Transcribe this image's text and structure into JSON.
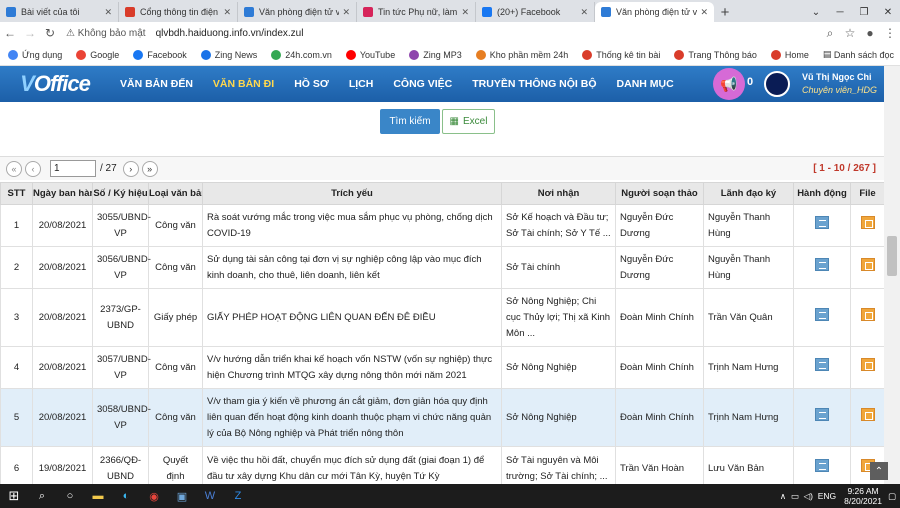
{
  "browser": {
    "tabs": [
      {
        "title": "Bài viết của tôi",
        "color": "#2e7bd6"
      },
      {
        "title": "Cổng thông tin điện tử",
        "color": "#d93c2a"
      },
      {
        "title": "Văn phòng điện tử vOffice",
        "color": "#2e7bd6"
      },
      {
        "title": "Tin tức Phụ nữ, làm đẹp",
        "color": "#d6245a"
      },
      {
        "title": "(20+) Facebook",
        "color": "#1877f2"
      },
      {
        "title": "Văn phòng điện tử vOffice",
        "color": "#2e7bd6"
      }
    ],
    "new_tab": "+",
    "url_security": "Không bảo mật",
    "url": "qlvbdh.haiduong.info.vn/index.zul",
    "bookmarks": [
      {
        "label": "Ứng dụng",
        "color": "#4285f4"
      },
      {
        "label": "Google",
        "color": "#ea4335"
      },
      {
        "label": "Facebook",
        "color": "#1877f2"
      },
      {
        "label": "Zing News",
        "color": "#1a73e8"
      },
      {
        "label": "24h.com.vn",
        "color": "#34a853"
      },
      {
        "label": "YouTube",
        "color": "#ff0000"
      },
      {
        "label": "Zing MP3",
        "color": "#8e44ad"
      },
      {
        "label": "Kho phần mềm 24h",
        "color": "#e67e22"
      },
      {
        "label": "Thống kê tin bài",
        "color": "#d93c2a"
      },
      {
        "label": "Trang Thông báo",
        "color": "#d93c2a"
      },
      {
        "label": "Home",
        "color": "#d93c2a"
      }
    ],
    "reading_list": "Danh sách đọc"
  },
  "app": {
    "logo_main": "V",
    "logo_rest": "Office",
    "menu": [
      "VĂN BẢN ĐẾN",
      "VĂN BẢN ĐI",
      "HỒ SƠ",
      "LỊCH",
      "CÔNG VIỆC",
      "TRUYỀN THÔNG NỘI BỘ",
      "DANH MỤC"
    ],
    "active_menu": "VĂN BẢN ĐI",
    "notification_count": "0",
    "user_name": "Vũ Thị Ngọc Chi",
    "user_role": "Chuyên viên_HDG"
  },
  "toolbar": {
    "search_label": "Tìm kiếm",
    "excel_label": "Excel"
  },
  "pager": {
    "current_page": "1",
    "total": "/ 27",
    "range": "[ 1 - 10 / 267 ]"
  },
  "table": {
    "headers": [
      "STT",
      "Ngày ban hành",
      "Số / Ký hiệu",
      "Loại văn bản",
      "Trích yếu",
      "Nơi nhận",
      "Người soạn thảo",
      "Lãnh đạo ký",
      "Hành động",
      "File"
    ],
    "rows": [
      {
        "stt": "1",
        "date": "20/08/2021",
        "number": "3055/UBND-VP",
        "type": "Công văn",
        "summary": "Rà soát vướng mắc trong việc mua sắm phục vụ phòng, chống dịch COVID-19",
        "recipients": "Sở Kế hoạch và Đầu tư; Sở Tài chính; Sở Y Tế ...",
        "drafter": "Nguyễn Đức Dương",
        "signer": "Nguyễn Thanh Hùng"
      },
      {
        "stt": "2",
        "date": "20/08/2021",
        "number": "3056/UBND-VP",
        "type": "Công văn",
        "summary": "Sử dụng tài sản công tại đơn vị sự nghiệp công lập vào mục đích kinh doanh, cho thuê, liên doanh, liên kết",
        "recipients": "Sở Tài chính",
        "drafter": "Nguyễn Đức Dương",
        "signer": "Nguyễn Thanh Hùng"
      },
      {
        "stt": "3",
        "date": "20/08/2021",
        "number": "2373/GP-UBND",
        "type": "Giấy phép",
        "summary": "GIẤY PHÉP HOẠT ĐỘNG LIÊN QUAN ĐẾN ĐÊ ĐIỀU",
        "recipients": "Sở Nông Nghiệp; Chi cục Thủy lợi; Thị xã Kinh Môn ...",
        "drafter": "Đoàn Minh Chính",
        "signer": "Trần Văn Quân"
      },
      {
        "stt": "4",
        "date": "20/08/2021",
        "number": "3057/UBND-VP",
        "type": "Công văn",
        "summary": "V/v hướng dẫn triển khai kế hoạch vốn NSTW (vốn sự nghiệp) thực hiện Chương trình MTQG xây dựng nông thôn mới năm 2021",
        "recipients": "Sở Nông Nghiệp",
        "drafter": "Đoàn Minh Chính",
        "signer": "Trịnh Nam Hưng"
      },
      {
        "stt": "5",
        "date": "20/08/2021",
        "number": "3058/UBND-VP",
        "type": "Công văn",
        "summary": "V/v tham gia ý kiến về phương án cắt giảm, đơn giản hóa quy định liên quan đến hoạt động kinh doanh thuộc phạm vi chức năng quản lý của Bộ Nông nghiệp và Phát triển nông thôn",
        "recipients": "Sở Nông Nghiệp",
        "drafter": "Đoàn Minh Chính",
        "signer": "Trịnh Nam Hưng"
      },
      {
        "stt": "6",
        "date": "19/08/2021",
        "number": "2366/QĐ-UBND",
        "type": "Quyết định",
        "summary": "Về việc thu hồi đất, chuyển mục đích sử dụng đất (giai đoạn 1) để đầu tư xây dựng Khu dân cư mới Tân Kỳ, huyện Tứ Kỳ",
        "recipients": "Sở Tài nguyên và Môi trường; Sở Tài chính; ...",
        "drafter": "Trần Văn Hoàn",
        "signer": "Lưu Văn Bản"
      }
    ]
  },
  "taskbar": {
    "lang": "ENG",
    "time": "9:26 AM",
    "date": "8/20/2021"
  }
}
